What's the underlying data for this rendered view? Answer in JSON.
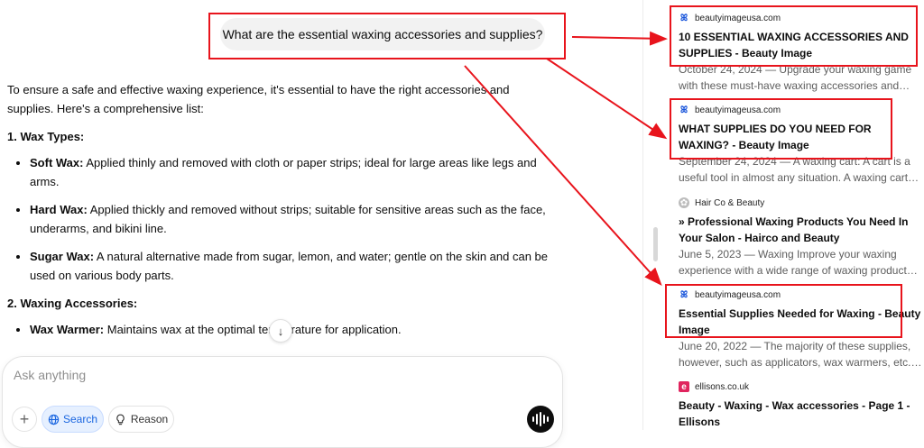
{
  "chat": {
    "user_message": "What are the essential waxing accessories and supplies?",
    "intro": "To ensure a safe and effective waxing experience, it's essential to have the right accessories and supplies. Here's a comprehensive list:",
    "section1": {
      "heading": "1. Wax Types:",
      "items": [
        {
          "term": "Soft Wax:",
          "text": " Applied thinly and removed with cloth or paper strips; ideal for large areas like legs and arms."
        },
        {
          "term": "Hard Wax:",
          "text": " Applied thickly and removed without strips; suitable for sensitive areas such as the face, underarms, and bikini line."
        },
        {
          "term": "Sugar Wax:",
          "text": " A natural alternative made from sugar, lemon, and water; gentle on the skin and can be used on various body parts."
        }
      ]
    },
    "section2": {
      "heading": "2. Waxing Accessories:",
      "items": [
        {
          "term": "Wax Warmer:",
          "text": " Maintains wax at the optimal temperature for application."
        }
      ]
    }
  },
  "composer": {
    "placeholder": "Ask anything",
    "plus_glyph": "+",
    "search_label": "Search",
    "reason_label": "Reason",
    "scroll_glyph": "↓"
  },
  "sources": [
    {
      "site": "beautyimageusa.com",
      "icon": "butterfly-icon",
      "title": "10 ESSENTIAL WAXING ACCESSORIES AND SUPPLIES - Beauty Image",
      "snippet": "October 24, 2024 — Upgrade your waxing game with these must-have waxing accessories and supplies...."
    },
    {
      "site": "beautyimageusa.com",
      "icon": "butterfly-icon",
      "title": "WHAT SUPPLIES DO YOU NEED FOR WAXING? - Beauty Image",
      "snippet": "September 24, 2024 — A waxing cart: A cart is a useful tool in almost any situation. A waxing cart hel..."
    },
    {
      "site": "Hair Co & Beauty",
      "icon": "haircoco-icon",
      "title": "» Professional Waxing Products You Need In Your Salon - Hairco and Beauty",
      "snippet": "June 5, 2023 — Waxing Improve your waxing experience with a wide range of waxing products an..."
    },
    {
      "site": "beautyimageusa.com",
      "icon": "butterfly-icon",
      "title": "Essential Supplies Needed for Waxing - Beauty Image",
      "snippet": "June 20, 2022 — The majority of these supplies, however, such as applicators, wax warmers, etc., ar..."
    },
    {
      "site": "ellisons.co.uk",
      "icon": "ellisons-icon",
      "title": "Beauty - Waxing - Wax accessories - Page 1 - Ellisons",
      "snippet": ""
    }
  ],
  "favicons": {
    "butterfly": "ꕤ",
    "haircoco": "✿",
    "ellisons": "e"
  },
  "colors": {
    "annotation": "#e8141c",
    "search_accent": "#1a66e0"
  }
}
